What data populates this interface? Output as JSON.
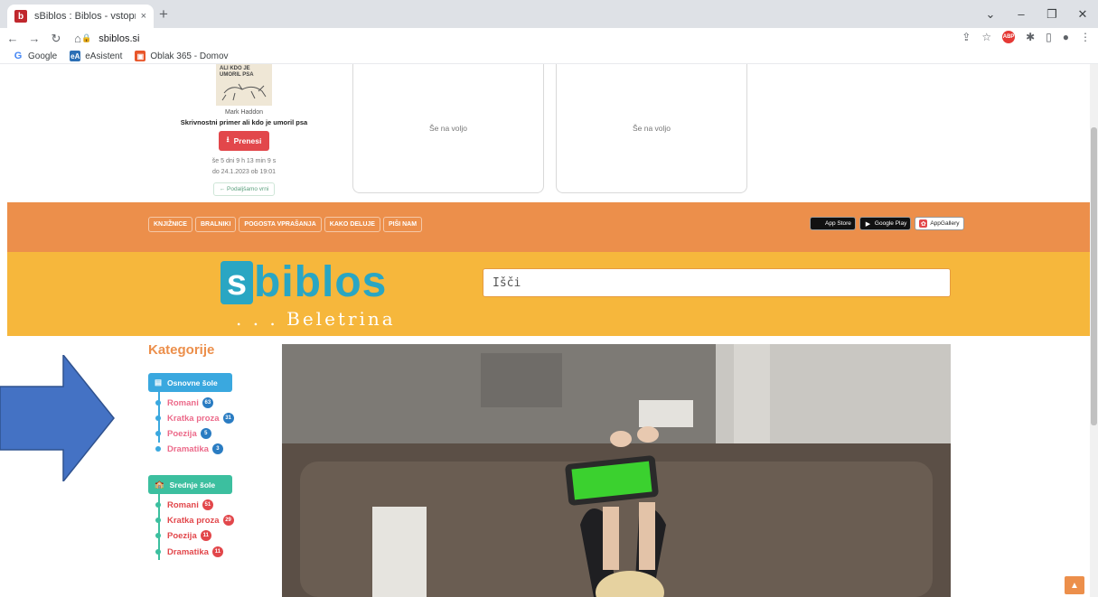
{
  "browser": {
    "tab_title": "sBiblos : Biblos - vstopna stran",
    "tab_close": "×",
    "new_tab": "+",
    "url": "sbiblos.si",
    "bookmarks": [
      {
        "label": "Google",
        "icon": "google-icon",
        "color": "#4285f4",
        "glyph": "G"
      },
      {
        "label": "eAsistent",
        "icon": "easistent-icon",
        "color": "#2c6fb5",
        "glyph": "eA"
      },
      {
        "label": "Oblak 365 - Domov",
        "icon": "office-icon",
        "color": "#e8562a",
        "glyph": "▣"
      }
    ],
    "window_controls": [
      "⌄",
      "–",
      "❐",
      "✕"
    ]
  },
  "book": {
    "cover_text": "ALI KDO JE UMORIL PSA",
    "author": "Mark Haddon",
    "title": "Skrivnostni primer ali kdo je umoril psa",
    "download_label": "Prenesi",
    "timer_line1": "še 5 dni 9 h 13 min 9 s",
    "timer_line2": "do 24.1.2023 ob 19:01",
    "extend_label": "← Podaljšamo vrni"
  },
  "slots": [
    "Še na voljo",
    "Še na voljo"
  ],
  "menu": [
    "KNJIŽNICE",
    "BRALNIKI",
    "POGOSTA VPRAŠANJA",
    "KAKO DELUJE",
    "PIŠI NAM"
  ],
  "stores": [
    {
      "label": "App Store",
      "icon": "apple-icon"
    },
    {
      "label": "Google Play",
      "icon": "google-play-icon"
    },
    {
      "label": "AppGallery",
      "icon": "huawei-icon"
    }
  ],
  "logo": {
    "s": "s",
    "word": "biblos",
    "tagline": ". . . Beletrina"
  },
  "search": {
    "placeholder": "Išči"
  },
  "categories": {
    "heading": "Kategorije",
    "groups": [
      {
        "label": "Osnovne šole",
        "items": [
          {
            "label": "Romani",
            "count": "63"
          },
          {
            "label": "Kratka proza",
            "count": "31"
          },
          {
            "label": "Poezija",
            "count": "5"
          },
          {
            "label": "Dramatika",
            "count": "3"
          }
        ]
      },
      {
        "label": "Srednje šole",
        "items": [
          {
            "label": "Romani",
            "count": "51"
          },
          {
            "label": "Kratka proza",
            "count": "29"
          },
          {
            "label": "Poezija",
            "count": "11"
          },
          {
            "label": "Dramatika",
            "count": "11"
          }
        ]
      }
    ]
  },
  "colors": {
    "orange": "#ec8f4b",
    "yellow": "#f6b73c",
    "brand_blue": "#2aa6c3",
    "arrow": "#4472c4"
  }
}
